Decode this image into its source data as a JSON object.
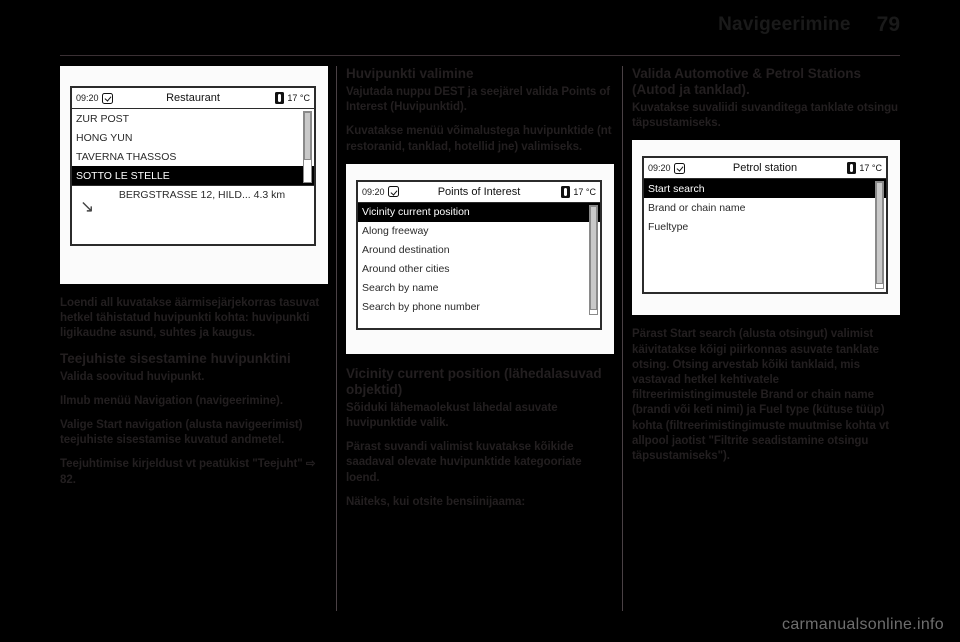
{
  "header": {
    "title": "Navigeerimine",
    "page_number": "79"
  },
  "watermark": "carmanualsonline.info",
  "columns": {
    "left": {
      "figure": {
        "status": {
          "clock": "09:20",
          "clock_icon": "clock-icon",
          "title": "Restaurant",
          "temp_icon": "thermometer-icon",
          "temperature": "17 °C"
        },
        "rows": [
          {
            "label": "ZUR POST",
            "chevron": "❯",
            "selected": false
          },
          {
            "label": "HONG YUN",
            "chevron": "❯",
            "selected": false
          },
          {
            "label": "TAVERNA THASSOS",
            "chevron": "❯",
            "selected": false
          },
          {
            "label": "SOTTO LE STELLE",
            "chevron": "❯",
            "selected": true
          }
        ],
        "footer": {
          "turn_icon": "turn-arrow-icon",
          "text": "BERGSTRASSE  12, HILD...  4.3  km"
        }
      },
      "paragraphs": [
        "Loendi all kuvatakse äärmisejärjekorras tasuvat hetkel tähistatud huvipunkti kohta: huvipunkti ligikaudne asund, suhtes ja kaugus.",
        "Teejuhiste sisestamine huvipunktini",
        "Valida soovitud huvipunkt.",
        "Ilmub menüü Navigation (navigeerimine).",
        "Valige Start navigation (alusta navigeerimist) teejuhiste sisestamise kuvatud andmetel.",
        "Teejuhtimise kirjeldust vt peatükist \"Teejuht\" ⇨ 82."
      ],
      "p0": "Loendi all kuvatakse äärmisejärjekorras tasuvat hetkel tähistatud huvipunkti kohta: huvipunkti ligikaudne asund, suhtes ja kaugus.",
      "h1": "Teejuhiste sisestamine huvipunktini",
      "p1": "Valida soovitud huvipunkt.",
      "p2": "Ilmub menüü Navigation (navigeerimine).",
      "p3": "Valige Start navigation (alusta navigeerimist) teejuhiste sisestamise kuvatud andmetel.",
      "p4": "Teejuhtimise kirjeldust vt peatükist \"Teejuht\" ⇨ 82."
    },
    "middle": {
      "h1": "Huvipunkti valimine",
      "p1": "Vajutada nuppu DEST ja seejärel valida Points of Interest (Huvipunktid).",
      "p2": "Kuvatakse menüü võimalustega huvipunktide (nt restoranid, tanklad, hotellid jne) valimiseks.",
      "figure": {
        "status": {
          "clock": "09:20",
          "clock_icon": "clock-icon",
          "title": "Points of Interest",
          "temp_icon": "thermometer-icon",
          "temperature": "17 °C"
        },
        "rows": [
          {
            "label": "Vicinity current position",
            "chevron": "❯",
            "selected": true
          },
          {
            "label": "Along freeway",
            "chevron": "❯",
            "selected": false
          },
          {
            "label": "Around destination",
            "chevron": "❯",
            "selected": false
          },
          {
            "label": "Around other cities",
            "chevron": "❯",
            "selected": false
          },
          {
            "label": "Search by name",
            "chevron": "❯",
            "selected": false
          },
          {
            "label": "Search by phone number",
            "chevron": "❯",
            "selected": false
          }
        ]
      },
      "h2": "Vicinity current position (lähedalasuvad objektid)",
      "p3": "Sõiduki lähemaolekust lähedal asuvate huvipunktide valik.",
      "p4": "Pärast suvandi valimist kuvatakse kõikide saadaval olevate huvipunktide kategooriate loend.",
      "p5": "Näiteks, kui otsite bensiinijaama:"
    },
    "right": {
      "h1": "Valida Automotive & Petrol Stations (Autod ja tanklad).",
      "p1": "Kuvatakse suvaliidi suvanditega tanklate otsingu täpsustamiseks.",
      "figure": {
        "status": {
          "clock": "09:20",
          "clock_icon": "clock-icon",
          "title": "Petrol station",
          "temp_icon": "thermometer-icon",
          "temperature": "17 °C"
        },
        "rows": [
          {
            "label": "Start search",
            "chevron": "❯",
            "selected": true
          },
          {
            "label": "Brand or chain name",
            "chevron": "❯",
            "selected": false
          },
          {
            "label": "Fueltype",
            "chevron": "❯",
            "selected": false
          }
        ]
      },
      "p2": "Pärast Start search (alusta otsingut) valimist käivitatakse kõigi piirkonnas asuvate tanklate otsing. Otsing arvestab kõiki tanklaid, mis vastavad hetkel kehtivatele filtreerimistingimustele Brand or chain name (brandi või keti nimi) ja Fuel type (kütuse tüüp) kohta (filtreerimistingimuste muutmise kohta vt allpool jaotist \"Filtrite seadistamine otsingu täpsustamiseks\")."
    }
  }
}
